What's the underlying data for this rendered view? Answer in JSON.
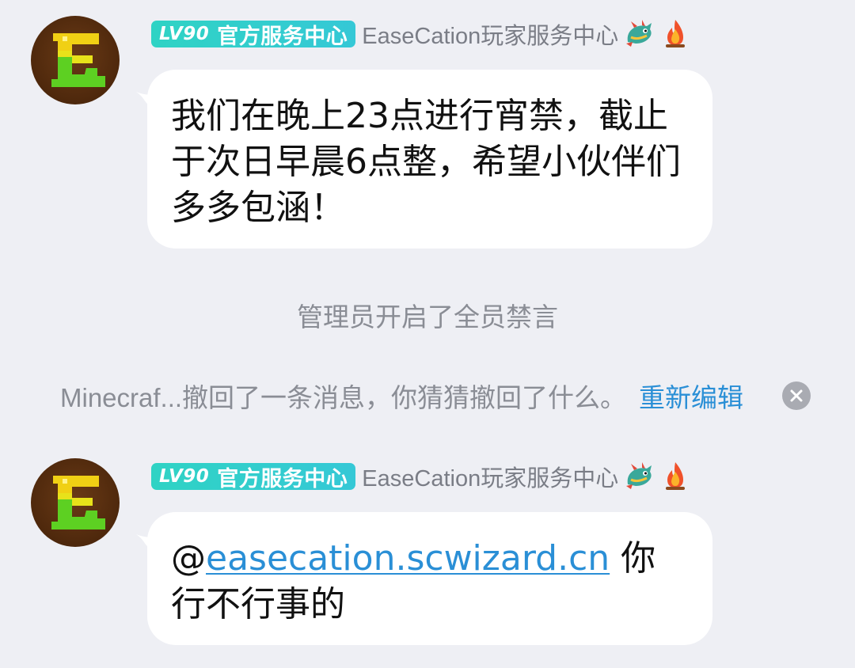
{
  "messages": [
    {
      "level": "LV90",
      "badge_title": "官方服务中心",
      "nickname": "EaseCation玩家服务中心",
      "avatar_letter": "E",
      "text": "我们在晚上23点进行宵禁，截止于次日早晨6点整，希望小伙伴们多多包涵！"
    },
    {
      "level": "LV90",
      "badge_title": "官方服务中心",
      "nickname": "EaseCation玩家服务中心",
      "avatar_letter": "E",
      "mention_prefix": "@",
      "mention_link": "easecation.scwizard.cn",
      "text_after": " 你行不行事的"
    }
  ],
  "system_notice": "管理员开启了全员禁言",
  "recall_notice": {
    "text": "Minecraf...撤回了一条消息，你猜猜撤回了什么。",
    "action": "重新编辑"
  },
  "icons": {
    "header_icon_1": "dragon-icon",
    "header_icon_2": "fire-icon",
    "close": "close-icon"
  },
  "colors": {
    "background": "#eeeff4",
    "badge": "#2fd3c4",
    "link": "#2a8fd6",
    "muted_text": "#8a8d95"
  }
}
